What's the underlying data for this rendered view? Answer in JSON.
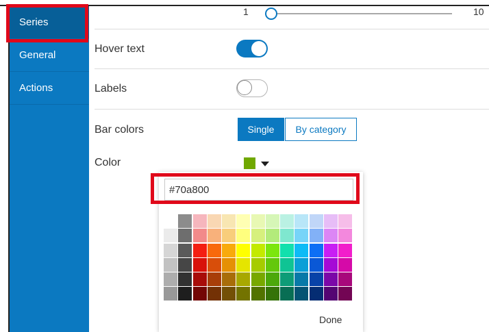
{
  "sidebar": {
    "items": [
      {
        "label": "Series",
        "active": true
      },
      {
        "label": "General",
        "active": false
      },
      {
        "label": "Actions",
        "active": false
      }
    ]
  },
  "slider": {
    "min_label": "1",
    "max_label": "10",
    "value": 1
  },
  "hover_text": {
    "label": "Hover text",
    "enabled": true
  },
  "labels": {
    "label": "Labels",
    "enabled": false
  },
  "bar_colors": {
    "label": "Bar colors",
    "options": [
      "Single",
      "By category"
    ],
    "selected": "Single"
  },
  "color": {
    "label": "Color",
    "value": "#70a800"
  },
  "color_picker": {
    "hex_value": "#70a800",
    "done_label": "Done",
    "palette": [
      [
        "#ffffff",
        "#8c8c8c",
        "#f6b6bd",
        "#f9d7b3",
        "#f8e6b2",
        "#ffffb3",
        "#e8f8b3",
        "#d6f6b7",
        "#baf1e3",
        "#b8e6f8",
        "#c0d6f8",
        "#e7bdf7",
        "#f6bde9"
      ],
      [
        "#ebebeb",
        "#6e6e6e",
        "#f28a8a",
        "#f8b17b",
        "#f8cd7b",
        "#ffff7e",
        "#d6f07d",
        "#b3eb7b",
        "#7fe7cf",
        "#77d4f8",
        "#82b1f7",
        "#dc86f5",
        "#f388dd"
      ],
      [
        "#d6d6d6",
        "#5a5a5a",
        "#f41e12",
        "#f8690c",
        "#f8aa0c",
        "#ffff00",
        "#c3ea00",
        "#7ce60d",
        "#12e0ad",
        "#0dbbf6",
        "#0d6ff5",
        "#c81ef4",
        "#f21ecb"
      ],
      [
        "#c2c2c2",
        "#464646",
        "#d8110a",
        "#d84e0a",
        "#e59004",
        "#e5e500",
        "#a6cc00",
        "#64c80c",
        "#0fc494",
        "#0a9fd7",
        "#0a58d6",
        "#a50ad6",
        "#d50aa8"
      ],
      [
        "#adadad",
        "#323232",
        "#a80c09",
        "#a83e09",
        "#a86d09",
        "#a8a800",
        "#78a800",
        "#4ca80b",
        "#0d9c77",
        "#0879a8",
        "#0842a8",
        "#7b08a8",
        "#a8087b"
      ],
      [
        "#999999",
        "#1e1e1e",
        "#730705",
        "#733105",
        "#735006",
        "#737300",
        "#527300",
        "#357308",
        "#086e54",
        "#055373",
        "#052d73",
        "#540573",
        "#730554"
      ]
    ]
  },
  "annotations": {
    "highlight_color": "#e0081a"
  }
}
